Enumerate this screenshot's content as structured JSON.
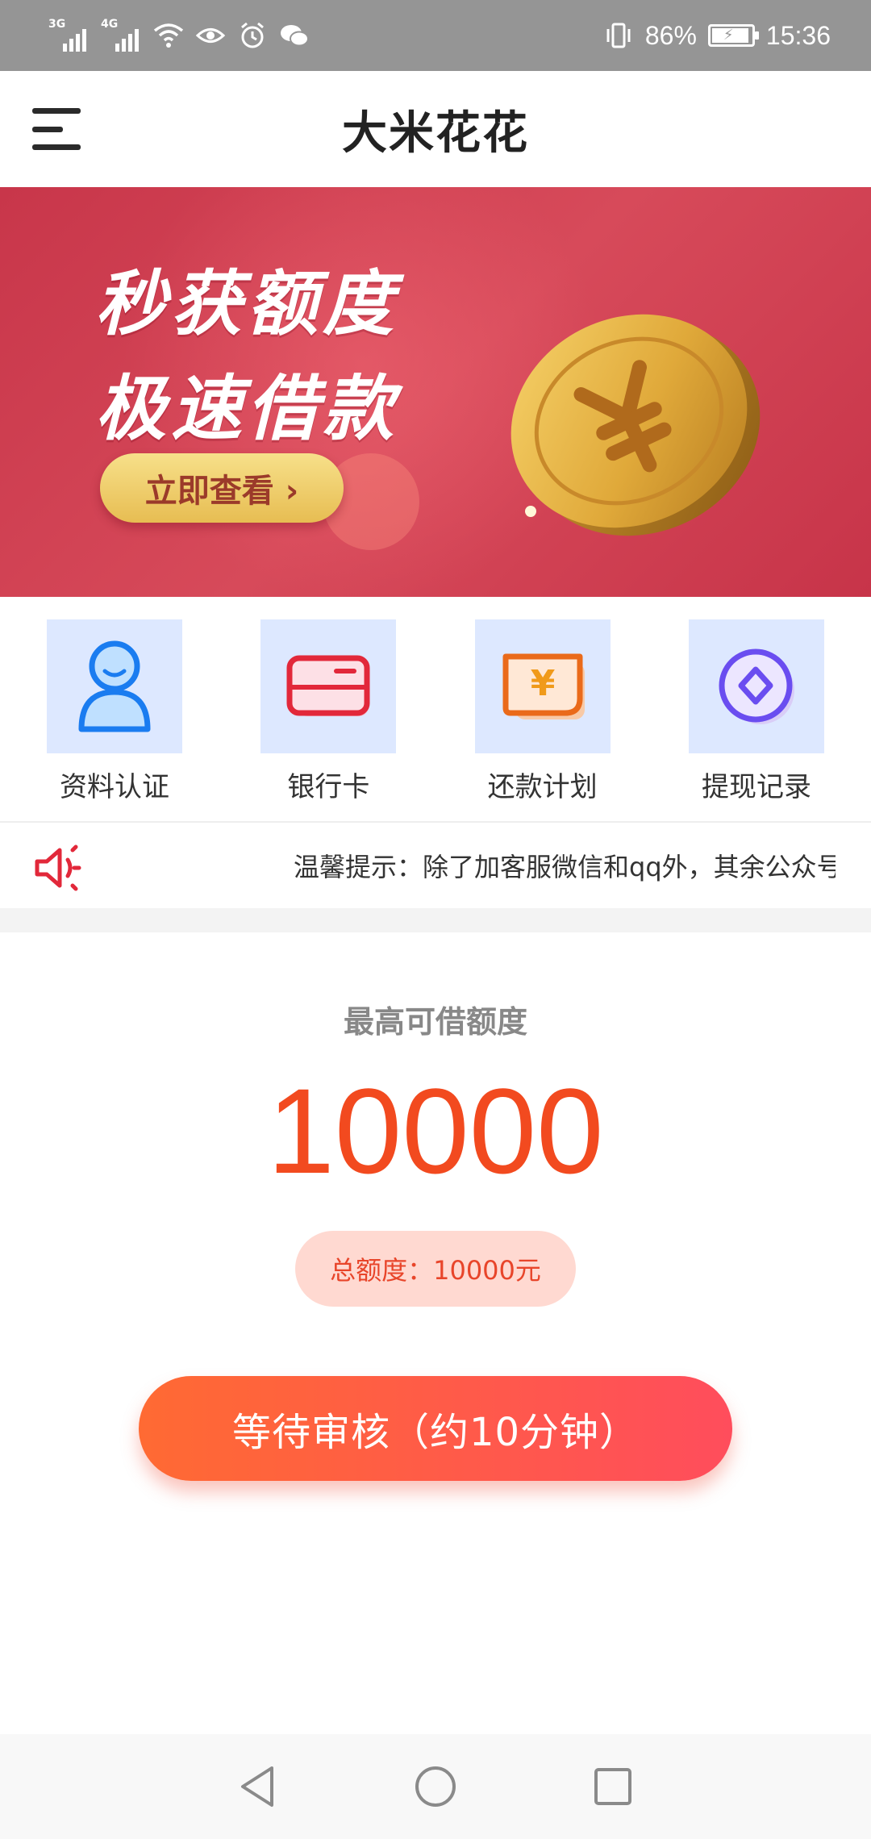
{
  "status_bar": {
    "network1": "3G",
    "network2": "4G",
    "battery_text": "86%",
    "time": "15:36"
  },
  "header": {
    "title": "大米花花"
  },
  "banner": {
    "line1": "秒获额度",
    "line2": "极速借款",
    "button_label": "立即查看 ›"
  },
  "shortcuts": [
    {
      "label": "资料认证",
      "icon": "profile-icon"
    },
    {
      "label": "银行卡",
      "icon": "bank-card-icon"
    },
    {
      "label": "还款计划",
      "icon": "repayment-plan-icon"
    },
    {
      "label": "提现记录",
      "icon": "withdraw-record-icon"
    }
  ],
  "notice": {
    "text": "温馨提示：除了加客服微信和qq外，其余公众号"
  },
  "credit": {
    "label": "最高可借额度",
    "amount": "10000",
    "total": "总额度：10000元",
    "button_label": "等待审核（约10分钟）"
  },
  "colors": {
    "accent": "#f24a1f",
    "banner": "#c8364a",
    "icon_bg": "#dde8ff"
  }
}
